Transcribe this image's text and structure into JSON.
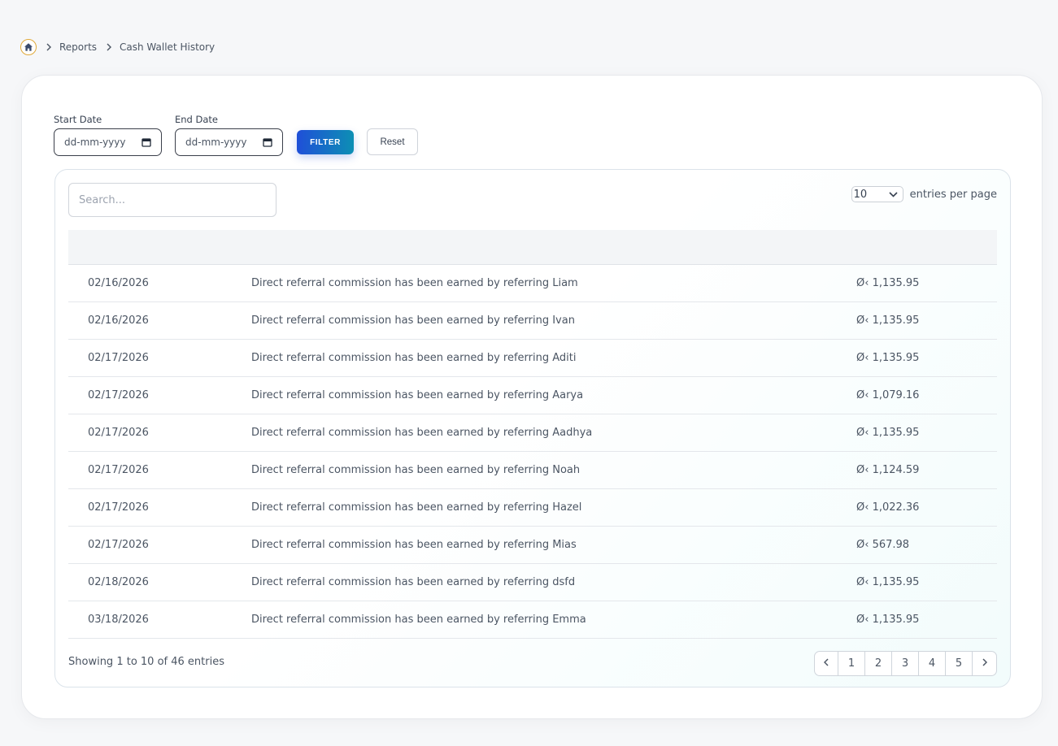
{
  "breadcrumb": {
    "home_icon": "home-icon",
    "items": [
      "Reports",
      "Cash Wallet History"
    ]
  },
  "filters": {
    "start_label": "Start Date",
    "start_value": "dd-mm-yyyy",
    "end_label": "End Date",
    "end_value": "dd-mm-yyyy",
    "filter_label": "FILTER",
    "reset_label": "Reset"
  },
  "table": {
    "search_placeholder": "Search...",
    "per_page_value": "10",
    "per_page_label": "entries per page",
    "rows": [
      {
        "date": "02/16/2026",
        "desc": "Direct referral commission has been earned by referring Liam",
        "amount": "Ø‹ 1,135.95"
      },
      {
        "date": "02/16/2026",
        "desc": "Direct referral commission has been earned by referring Ivan",
        "amount": "Ø‹ 1,135.95"
      },
      {
        "date": "02/17/2026",
        "desc": "Direct referral commission has been earned by referring Aditi",
        "amount": "Ø‹ 1,135.95"
      },
      {
        "date": "02/17/2026",
        "desc": "Direct referral commission has been earned by referring Aarya",
        "amount": "Ø‹ 1,079.16"
      },
      {
        "date": "02/17/2026",
        "desc": "Direct referral commission has been earned by referring Aadhya",
        "amount": "Ø‹ 1,135.95"
      },
      {
        "date": "02/17/2026",
        "desc": "Direct referral commission has been earned by referring Noah",
        "amount": "Ø‹ 1,124.59"
      },
      {
        "date": "02/17/2026",
        "desc": "Direct referral commission has been earned by referring Hazel",
        "amount": "Ø‹ 1,022.36"
      },
      {
        "date": "02/17/2026",
        "desc": "Direct referral commission has been earned by referring Mias",
        "amount": "Ø‹ 567.98"
      },
      {
        "date": "02/18/2026",
        "desc": "Direct referral commission has been earned by referring dsfd",
        "amount": "Ø‹ 1,135.95"
      },
      {
        "date": "03/18/2026",
        "desc": "Direct referral commission has been earned by referring Emma",
        "amount": "Ø‹ 1,135.95"
      }
    ],
    "showing_text": "Showing 1 to 10 of 46 entries",
    "pages": [
      "1",
      "2",
      "3",
      "4",
      "5"
    ]
  },
  "colors": {
    "accent_start": "#1f4fd8",
    "accent_end": "#0d8fb4",
    "home_ring": "#e0a93a"
  }
}
